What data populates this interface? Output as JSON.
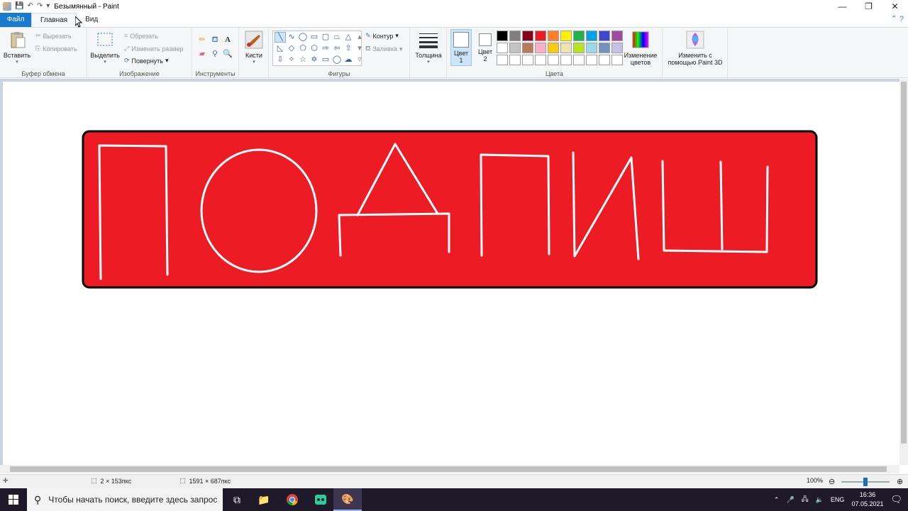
{
  "window": {
    "title": "Безымянный - Paint",
    "controls": [
      "—",
      "❐",
      "✕"
    ]
  },
  "tabs": [
    {
      "label": "Файл"
    },
    {
      "label": "Главная"
    },
    {
      "label": "Вид"
    }
  ],
  "ribbon": {
    "clipboard": {
      "paste": "Вставить",
      "cut": "Вырезать",
      "copy": "Копировать",
      "group": "Буфер обмена"
    },
    "image": {
      "select": "Выделить",
      "crop": "Обрезать",
      "resize": "Изменить размер",
      "rotate": "Повернуть",
      "group": "Изображение"
    },
    "tools": {
      "group": "Инструменты"
    },
    "brushes": {
      "label": "Кисти"
    },
    "shapes": {
      "outline": "Контур",
      "fill": "Заливка",
      "group": "Фигуры"
    },
    "size": {
      "label": "Толщина"
    },
    "colors": {
      "color1": "Цвет 1",
      "color2": "Цвет 2",
      "edit": "Изменение цветов",
      "group": "Цвета",
      "palette": [
        "#000000",
        "#7f7f7f",
        "#880015",
        "#ed1c24",
        "#ff7f27",
        "#fff200",
        "#22b14c",
        "#00a2e8",
        "#3f48cc",
        "#a349a4",
        "#ffffff",
        "#c3c3c3",
        "#b97a57",
        "#ffaec9",
        "#ffc90e",
        "#efe4b0",
        "#b5e61d",
        "#99d9ea",
        "#7092be",
        "#c8bfe7",
        "#ffffff",
        "#ffffff",
        "#ffffff",
        "#ffffff",
        "#ffffff",
        "#ffffff",
        "#ffffff",
        "#ffffff",
        "#ffffff",
        "#ffffff"
      ]
    },
    "paint3d": "Изменить с помощью Paint 3D"
  },
  "canvas": {
    "banner_color": "#ed1c24",
    "stroke_color": "#ffffff"
  },
  "status": {
    "selection_size": "2 × 153пкс",
    "image_size": "1591 × 687пкс",
    "zoom": "100%"
  },
  "taskbar": {
    "search_placeholder": "Чтобы начать поиск, введите здесь запрос",
    "language": "ENG",
    "time": "16:36",
    "date": "07.05.2021"
  }
}
